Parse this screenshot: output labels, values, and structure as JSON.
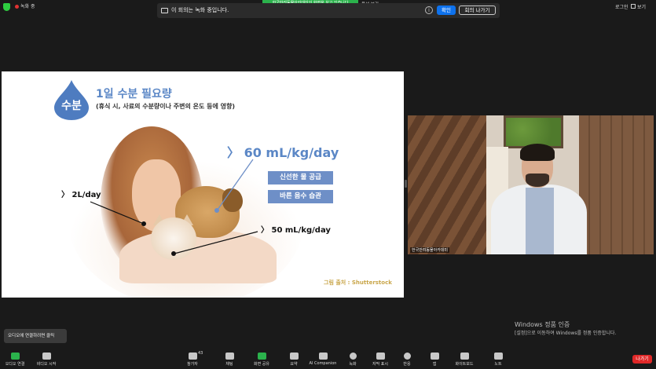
{
  "topbar": {
    "recording_status": "녹화 중",
    "notification": "한국반려동물아카데미의 화면을 보고 있습니다",
    "view_options": "옵션 보기",
    "login_label": "로그인",
    "view_label": "보기"
  },
  "recording_banner": {
    "message": "이 회의는 녹화 중입니다.",
    "confirm_label": "확인",
    "leave_label": "회의 나가기"
  },
  "slide": {
    "drop_label": "수분",
    "title": "1일 수분 필요량",
    "subtitle": "(휴식 시, 사료의 수분량이나 주변의 온도 등에 영향)",
    "big_stat": "〉 60 mL/kg/day",
    "tag1": "신선한 물 공급",
    "tag2": "바른 음수 습관",
    "label_human": "〉 2L/day",
    "label_cat": "〉 50 mL/kg/day",
    "credit": "그림 출처 : Shutterstock",
    "colors": {
      "accent": "#5b87c6",
      "tag_bg": "#6e8fc7"
    }
  },
  "video": {
    "participant_name": "한국반려동물아카데미"
  },
  "windows_watermark": {
    "title": "Windows 정품 인증",
    "subtitle": "[설정]으로 이동하여 Windows를 정품 인증합니다."
  },
  "tooltip": {
    "text": "오디오에 연결하려면 클릭"
  },
  "toolbar": {
    "audio": "오디오 연결",
    "video": "비디오 시작",
    "participants": "참가자",
    "participants_count": "43",
    "chat": "채팅",
    "share": "화면 공유",
    "summary": "요약",
    "ai": "AI Companion",
    "record": "녹화",
    "captions": "자막 표시",
    "reactions": "반응",
    "apps": "앱",
    "whiteboard": "화이트보드",
    "notes": "노트",
    "leave": "나가기"
  }
}
